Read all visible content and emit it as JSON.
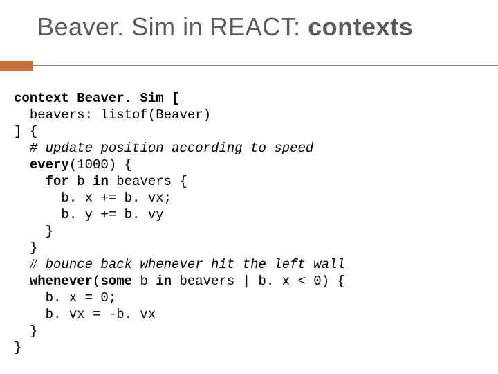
{
  "title_plain": "Beaver. Sim in REACT: ",
  "title_bold": "contexts",
  "code_lines": [
    {
      "indent": 0,
      "segs": [
        {
          "t": "context Beaver. Sim [",
          "b": true,
          "i": false
        }
      ]
    },
    {
      "indent": 1,
      "segs": [
        {
          "t": "beavers: listof(Beaver)",
          "b": false,
          "i": false
        }
      ]
    },
    {
      "indent": 0,
      "segs": [
        {
          "t": "] {",
          "b": false,
          "i": false
        }
      ]
    },
    {
      "indent": 1,
      "segs": [
        {
          "t": "# update position according to speed",
          "b": false,
          "i": true
        }
      ]
    },
    {
      "indent": 1,
      "segs": [
        {
          "t": "every",
          "b": true,
          "i": false
        },
        {
          "t": "(1000) {",
          "b": false,
          "i": false
        }
      ]
    },
    {
      "indent": 2,
      "segs": [
        {
          "t": "for",
          "b": true,
          "i": false
        },
        {
          "t": " b ",
          "b": false,
          "i": false
        },
        {
          "t": "in",
          "b": true,
          "i": false
        },
        {
          "t": " beavers {",
          "b": false,
          "i": false
        }
      ]
    },
    {
      "indent": 3,
      "segs": [
        {
          "t": "b. x += b. vx;",
          "b": false,
          "i": false
        }
      ]
    },
    {
      "indent": 3,
      "segs": [
        {
          "t": "b. y += b. vy",
          "b": false,
          "i": false
        }
      ]
    },
    {
      "indent": 2,
      "segs": [
        {
          "t": "}",
          "b": false,
          "i": false
        }
      ]
    },
    {
      "indent": 1,
      "segs": [
        {
          "t": "}",
          "b": false,
          "i": false
        }
      ]
    },
    {
      "indent": 1,
      "segs": [
        {
          "t": "# bounce back whenever hit the left wall",
          "b": false,
          "i": true
        }
      ]
    },
    {
      "indent": 1,
      "segs": [
        {
          "t": "whenever",
          "b": true,
          "i": false
        },
        {
          "t": "(",
          "b": false,
          "i": false
        },
        {
          "t": "some",
          "b": true,
          "i": false
        },
        {
          "t": " b ",
          "b": false,
          "i": false
        },
        {
          "t": "in",
          "b": true,
          "i": false
        },
        {
          "t": " beavers | b. x < 0) {",
          "b": false,
          "i": false
        }
      ]
    },
    {
      "indent": 2,
      "segs": [
        {
          "t": "b. x = 0;",
          "b": false,
          "i": false
        }
      ]
    },
    {
      "indent": 2,
      "segs": [
        {
          "t": "b. vx = -b. vx",
          "b": false,
          "i": false
        }
      ]
    },
    {
      "indent": 1,
      "segs": [
        {
          "t": "}",
          "b": false,
          "i": false
        }
      ]
    },
    {
      "indent": 0,
      "segs": [
        {
          "t": "}",
          "b": false,
          "i": false
        }
      ]
    }
  ]
}
